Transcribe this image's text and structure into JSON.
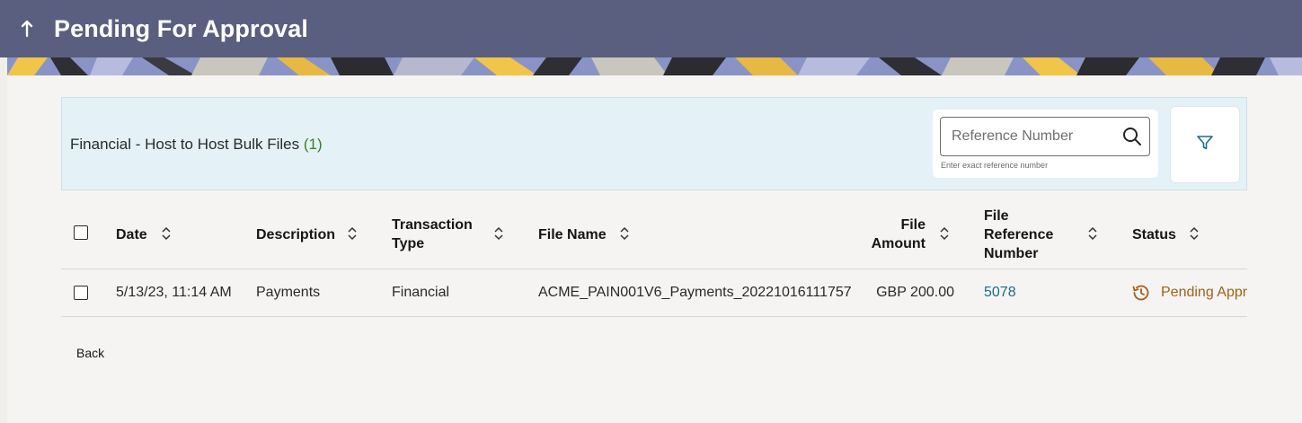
{
  "header": {
    "title": "Pending For Approval",
    "back_icon": "arrow-up-icon"
  },
  "panel": {
    "title": "Financial - Host to Host Bulk Files",
    "count": "(1)",
    "search": {
      "placeholder": "Reference Number",
      "value": "",
      "hint": "Enter exact reference number"
    }
  },
  "table": {
    "columns": {
      "date": "Date",
      "description": "Description",
      "transaction_type": "Transaction Type",
      "file_name": "File Name",
      "file_amount": "File Amount",
      "file_reference_number": "File Reference Number",
      "status": "Status"
    },
    "rows": [
      {
        "date": "5/13/23, 11:14 AM",
        "description": "Payments",
        "transaction_type": "Financial",
        "file_name": "ACME_PAIN001V6_Payments_20221016111757",
        "file_amount": "GBP 200.00",
        "file_reference_number": "5078",
        "status": "Pending Appr"
      }
    ]
  },
  "footer": {
    "back_label": "Back"
  },
  "colors": {
    "header_bg": "#5a5e7f",
    "panel_bg": "#e4f1f7",
    "link": "#1d6a8a",
    "status_pending": "#a1611a",
    "count": "#3d7d2a"
  }
}
